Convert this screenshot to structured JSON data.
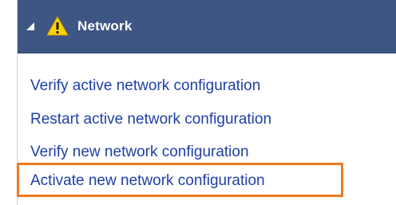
{
  "panel": {
    "title": "Network",
    "toggle_icon": "collapse-triangle-icon",
    "status_icon": "warning-icon",
    "colors": {
      "header_background": "#3e5683",
      "warning_fill": "#ffd200",
      "link": "#1f3fa6",
      "highlight_border": "#f07a1f"
    }
  },
  "actions": [
    {
      "label": "Verify active network configuration"
    },
    {
      "label": "Restart active network configuration"
    },
    {
      "label": "Verify new network configuration"
    },
    {
      "label": "Activate new network configuration",
      "highlighted": true
    }
  ]
}
